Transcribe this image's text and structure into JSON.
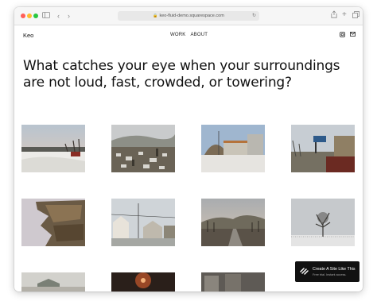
{
  "browser": {
    "url": "keo-fluid-demo.squarespace.com",
    "icons": {
      "sidebar": "sidebar-icon",
      "back": "chevron-left-icon",
      "forward": "chevron-right-icon",
      "share": "share-icon",
      "new_tab": "plus-icon",
      "tabs": "tabs-icon",
      "lock": "lock-icon",
      "reload": "reload-icon"
    }
  },
  "site": {
    "logo": "Keo",
    "nav": [
      "WORK",
      "ABOUT"
    ],
    "social_icons": [
      "instagram-icon",
      "mail-icon"
    ],
    "headline": "What catches your eye when your surroundings are not loud, fast, crowded, or towering?"
  },
  "gallery": {
    "photos": [
      "winter-lakeshore-photo",
      "hillside-town-photo",
      "quonset-hut-photo",
      "roadside-sign-photo",
      "rock-outcrop-photo",
      "small-town-houses-photo",
      "dusk-road-hills-photo",
      "lone-tree-snow-photo",
      "farm-building-photo",
      "night-light-photo",
      "gray-building-photo"
    ]
  },
  "cta": {
    "title": "Create A Site Like This",
    "subtitle": "Free trial. Instant access."
  },
  "colors": {
    "background": "#ffffff",
    "text": "#111111",
    "cta_background": "#111111",
    "chrome": "#f6f6f6"
  }
}
